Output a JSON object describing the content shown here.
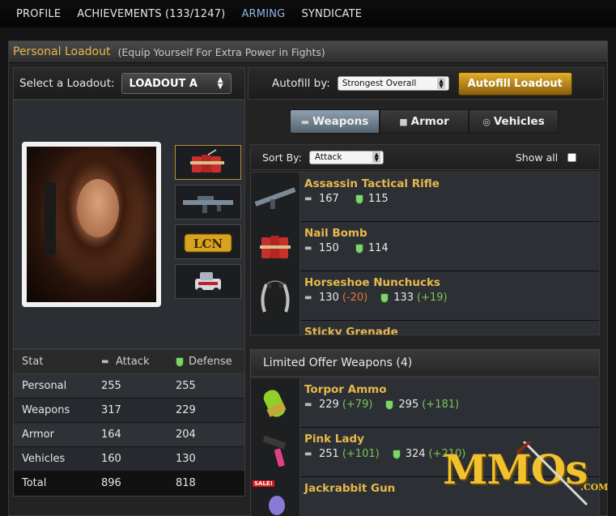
{
  "nav": {
    "items": [
      "PROFILE",
      "ACHIEVEMENTS (133/1247)",
      "ARMING",
      "SYNDICATE"
    ],
    "active": "ARMING"
  },
  "header": {
    "title": "Personal Loadout",
    "subtitle": "(Equip Yourself For Extra Power in Fights)"
  },
  "loadout": {
    "label": "Select a Loadout:",
    "value": "LOADOUT A"
  },
  "autofill": {
    "label": "Autofill by:",
    "value": "Strongest Overall",
    "button": "Autofill Loadout"
  },
  "tabs": [
    "Weapons",
    "Armor",
    "Vehicles"
  ],
  "sort": {
    "label": "Sort By:",
    "value": "Attack",
    "show_all": "Show all"
  },
  "items": [
    {
      "name": "Assassin Tactical Rifle",
      "attack": "167",
      "attack_delta": "",
      "defense": "115",
      "defense_delta": ""
    },
    {
      "name": "Nail Bomb",
      "attack": "150",
      "attack_delta": "",
      "defense": "114",
      "defense_delta": ""
    },
    {
      "name": "Horseshoe Nunchucks",
      "attack": "130",
      "attack_delta": "(-20)",
      "defense": "133",
      "defense_delta": "(+19)"
    },
    {
      "name": "Sticky Grenade",
      "attack": "",
      "attack_delta": "",
      "defense": "",
      "defense_delta": ""
    }
  ],
  "limited": {
    "title": "Limited Offer Weapons (4)",
    "sale_badge": "SALE!",
    "items": [
      {
        "name": "Torpor Ammo",
        "attack": "229",
        "attack_delta": "(+79)",
        "defense": "295",
        "defense_delta": "(+181)"
      },
      {
        "name": "Pink Lady",
        "attack": "251",
        "attack_delta": "(+101)",
        "defense": "324",
        "defense_delta": "(+210)"
      },
      {
        "name": "Jackrabbit Gun",
        "attack": "",
        "attack_delta": "",
        "defense": "",
        "defense_delta": ""
      }
    ]
  },
  "stats": {
    "headers": [
      "Stat",
      "Attack",
      "Defense"
    ],
    "rows": [
      [
        "Personal",
        "255",
        "255"
      ],
      [
        "Weapons",
        "317",
        "229"
      ],
      [
        "Armor",
        "164",
        "204"
      ],
      [
        "Vehicles",
        "160",
        "130"
      ],
      [
        "Total",
        "896",
        "818"
      ]
    ]
  },
  "watermark": {
    "text": "MMOs",
    "suffix": ".COM"
  },
  "colors": {
    "accent": "#e8b84a",
    "positive": "#7ec25a",
    "negative": "#e07a3a",
    "nav_active": "#8fb3e3"
  }
}
